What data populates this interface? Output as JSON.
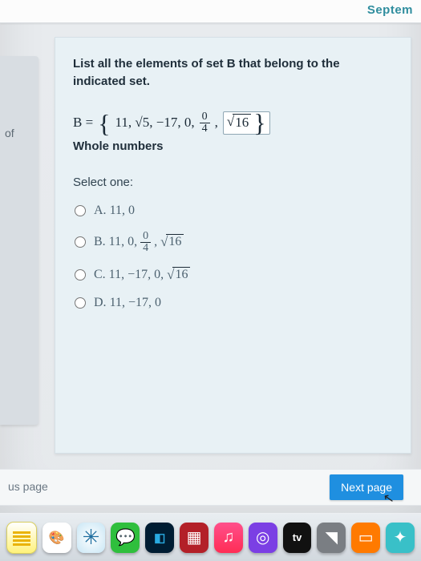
{
  "chrome": {
    "partial_text": "Septem"
  },
  "sidebar": {
    "fragment": "of"
  },
  "question": {
    "prompt": "List all the elements of set B that belong to the indicated set.",
    "set_label": "B =",
    "elements_prefix": "11, √5, −17, 0,",
    "frac_num": "0",
    "frac_den": "4",
    "last_radicand": "16",
    "subset_label": "Whole numbers",
    "select_label": "Select one:"
  },
  "options": [
    {
      "letter": "A.",
      "plain": "11, 0"
    },
    {
      "letter": "B.",
      "plain": "11, 0,",
      "frac_num": "0",
      "frac_den": "4",
      "radicand": "16"
    },
    {
      "letter": "C.",
      "plain": "11, −17, 0,",
      "radicand": "16"
    },
    {
      "letter": "D.",
      "plain": "11, −17, 0"
    }
  ],
  "nav": {
    "prev": "us page",
    "next": "Next page"
  },
  "dock": {
    "tv": "tv"
  }
}
